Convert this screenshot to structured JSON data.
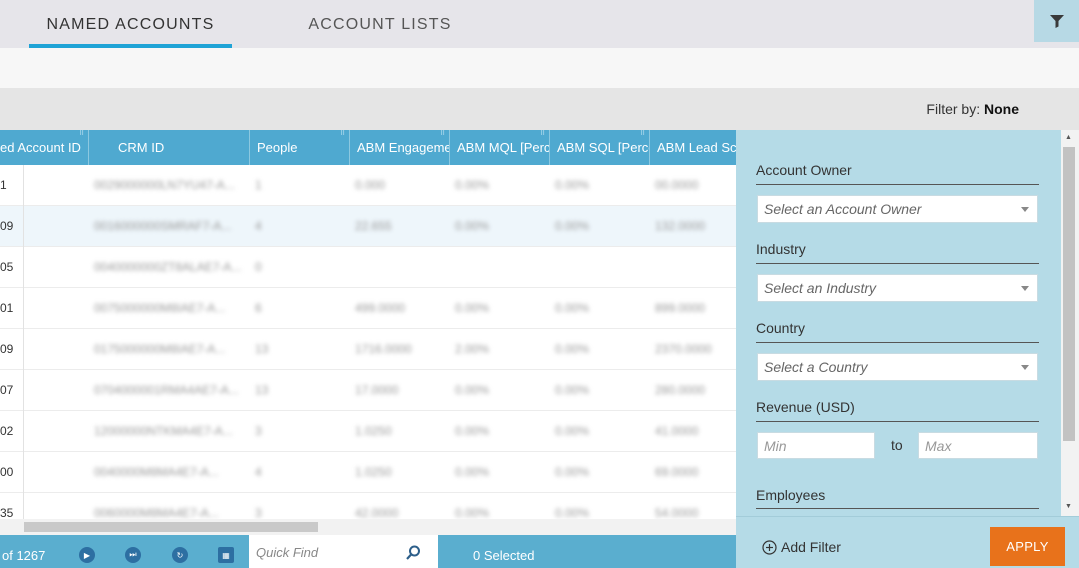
{
  "tabs": [
    {
      "label": "NAMED ACCOUNTS",
      "active": true
    },
    {
      "label": "ACCOUNT LISTS",
      "active": false
    }
  ],
  "filter_bar": {
    "label": "Filter by:",
    "value": "None"
  },
  "grid": {
    "columns": [
      {
        "label": "ed Account ID"
      },
      {
        "label": "CRM ID"
      },
      {
        "label": "People"
      },
      {
        "label": "ABM Engagement"
      },
      {
        "label": "ABM MQL [Percent]"
      },
      {
        "label": "ABM SQL [Percent]"
      },
      {
        "label": "ABM Lead Score"
      }
    ],
    "rows": [
      {
        "id": "1",
        "crm": "0029000000LN7YU47-A...",
        "people": "1",
        "eng": "0.000",
        "mql": "0.00%",
        "sql": "0.00%",
        "score": "00.0000"
      },
      {
        "id": "09",
        "crm": "0016000000SMRAF7-A...",
        "people": "4",
        "eng": "22.655",
        "mql": "0.00%",
        "sql": "0.00%",
        "score": "132.0000"
      },
      {
        "id": "05",
        "crm": "0040000000ZT8ALAE7-A...",
        "people": "0",
        "eng": "",
        "mql": "",
        "sql": "",
        "score": ""
      },
      {
        "id": "01",
        "crm": "0075000000M8IAE7-A...",
        "people": "6",
        "eng": "499.0000",
        "mql": "0.00%",
        "sql": "0.00%",
        "score": "899.0000"
      },
      {
        "id": "09",
        "crm": "0175000000M8IAE7-A...",
        "people": "13",
        "eng": "1716.0000",
        "mql": "2.00%",
        "sql": "0.00%",
        "score": "2370.0000"
      },
      {
        "id": "07",
        "crm": "0704000001RMA4AE7-A...",
        "people": "13",
        "eng": "17.0000",
        "mql": "0.00%",
        "sql": "0.00%",
        "score": "280.0000"
      },
      {
        "id": "02",
        "crm": "12000000NTKMA4E7-A...",
        "people": "3",
        "eng": "1.0250",
        "mql": "0.00%",
        "sql": "0.00%",
        "score": "41.0000"
      },
      {
        "id": "00",
        "crm": "0040000M8MA4E7-A...",
        "people": "4",
        "eng": "1.0250",
        "mql": "0.00%",
        "sql": "0.00%",
        "score": "69.0000"
      },
      {
        "id": "35",
        "crm": "0060000M8MA4E7-A...",
        "people": "3",
        "eng": "42.0000",
        "mql": "0.00%",
        "sql": "0.00%",
        "score": "54.0000"
      }
    ]
  },
  "footer": {
    "count": "of 1267",
    "quick_find_placeholder": "Quick Find",
    "selected": "0 Selected"
  },
  "filters": {
    "account_owner": {
      "label": "Account Owner",
      "placeholder": "Select an Account Owner"
    },
    "industry": {
      "label": "Industry",
      "placeholder": "Select an Industry"
    },
    "country": {
      "label": "Country",
      "placeholder": "Select a Country"
    },
    "revenue": {
      "label": "Revenue (USD)",
      "min_placeholder": "Min",
      "to": "to",
      "max_placeholder": "Max"
    },
    "employees": {
      "label": "Employees"
    }
  },
  "add_filter": "Add Filter",
  "apply": "APPLY",
  "colors": {
    "accent_blue": "#4fa9d0",
    "tab_underline": "#1fa3d6",
    "panel": "#b5dbe7",
    "apply": "#e8721b"
  }
}
